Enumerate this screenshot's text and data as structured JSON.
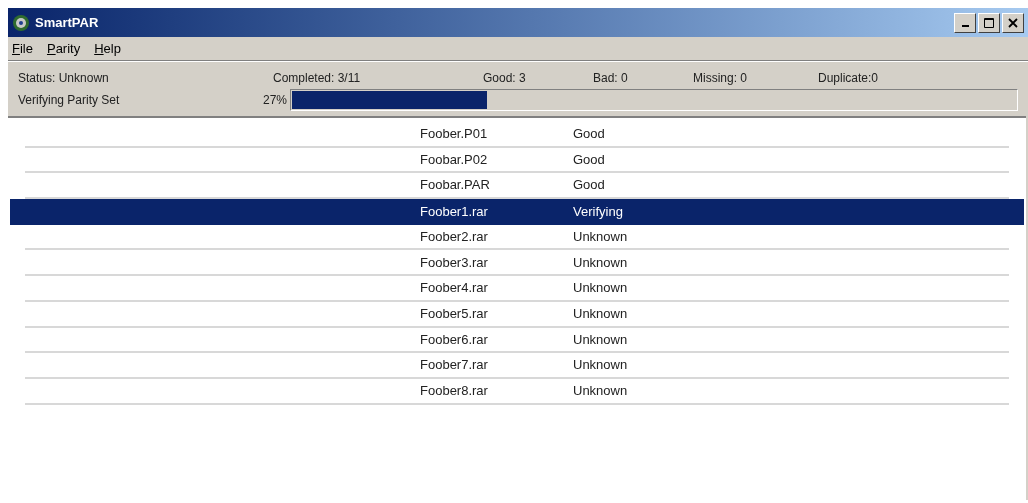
{
  "window": {
    "title": "SmartPAR"
  },
  "menu": [
    "File",
    "Parity",
    "Help"
  ],
  "status": {
    "state": "Status: Unknown",
    "completed": "Completed: 3/11",
    "good": "Good: 3",
    "bad": "Bad: 0",
    "missing": "Missing: 0",
    "duplicate": "Duplicate:0",
    "activity": "Verifying Parity Set",
    "percent": "27%",
    "level": 0.27
  },
  "files": [
    {
      "name": "Foober.P01",
      "status": "Good",
      "selected": false
    },
    {
      "name": "Foobar.P02",
      "status": "Good",
      "selected": false
    },
    {
      "name": "Foobar.PAR",
      "status": "Good",
      "selected": false
    },
    {
      "name": "Foober1.rar",
      "status": "Verifying",
      "selected": true
    },
    {
      "name": "Foober2.rar",
      "status": "Unknown",
      "selected": false
    },
    {
      "name": "Foober3.rar",
      "status": "Unknown",
      "selected": false
    },
    {
      "name": "Foober4.rar",
      "status": "Unknown",
      "selected": false
    },
    {
      "name": "Foober5.rar",
      "status": "Unknown",
      "selected": false
    },
    {
      "name": "Foober6.rar",
      "status": "Unknown",
      "selected": false
    },
    {
      "name": "Foober7.rar",
      "status": "Unknown",
      "selected": false
    },
    {
      "name": "Foober8.rar",
      "status": "Unknown",
      "selected": false
    }
  ]
}
